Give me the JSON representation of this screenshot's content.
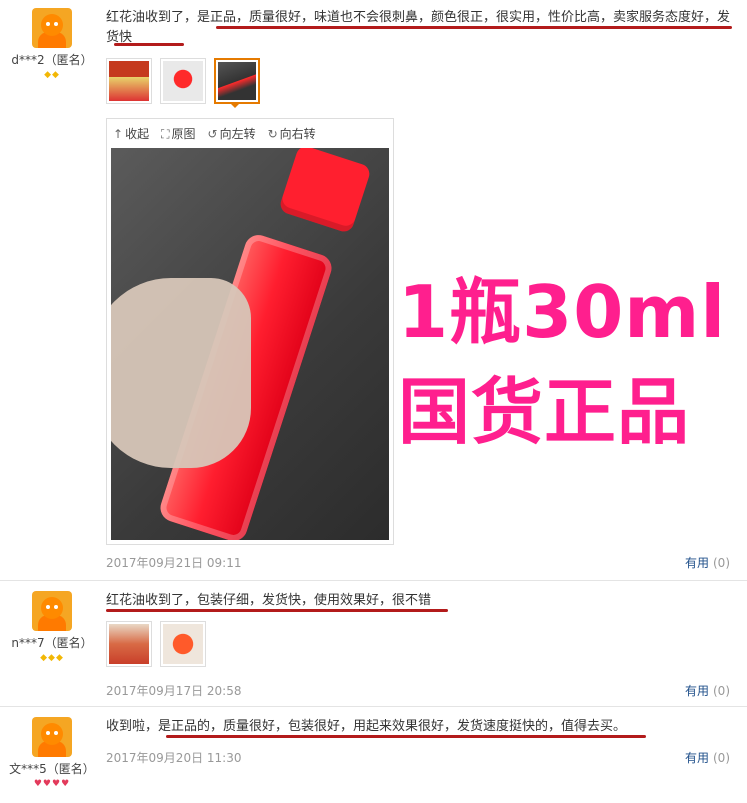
{
  "reviews": [
    {
      "user": "d***2（匿名）",
      "badges": "◆◆",
      "badge_color": "#f2b705",
      "text": "红花油收到了，是正品，质量很好，味道也不会很刺鼻，颜色很正，很实用，性价比高，卖家服务态度好，发货快",
      "date": "2017年09月21日 09:11",
      "helpful_label": "有用",
      "helpful_count": "(0)",
      "viewer_tools": [
        "收起",
        "原图",
        "向左转",
        "向右转"
      ],
      "overlay_line1": "1瓶30ml",
      "overlay_line2": "国货正品"
    },
    {
      "user": "n***7（匿名）",
      "badges": "◆◆◆",
      "badge_color": "#f2b705",
      "text": "红花油收到了，包装仔细，发货快，使用效果好，很不错",
      "date": "2017年09月17日 20:58",
      "helpful_label": "有用",
      "helpful_count": "(0)"
    },
    {
      "user": "文***5（匿名）",
      "badges": "♥♥♥♥",
      "badge_color": "#e33a5b",
      "text": "收到啦，是正品的，质量很好，包装很好，用起来效果很好，发货速度挺快的，值得去买。",
      "date": "2017年09月20日 11:30",
      "helpful_label": "有用",
      "helpful_count": "(0)"
    }
  ]
}
